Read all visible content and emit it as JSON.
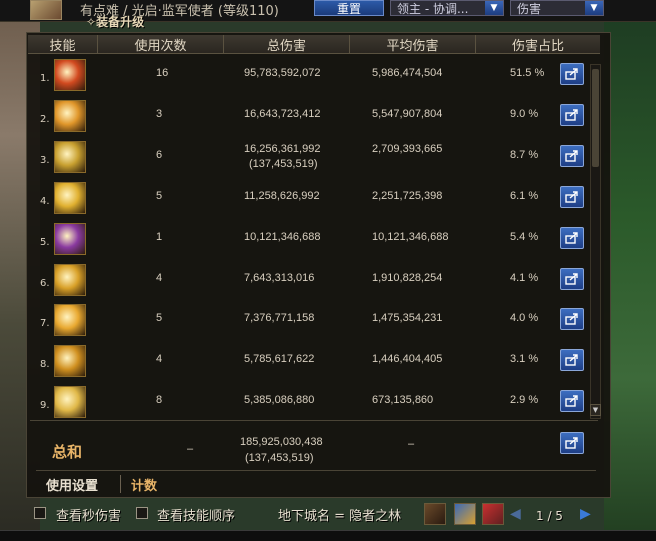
{
  "header": {
    "title": "有点难 / 光启·监军使者 (等级110)",
    "equip_upgrade": "装备升级",
    "reset_label": "重置",
    "dropdown_boss": "领主 - 协调...",
    "dropdown_metric": "伤害"
  },
  "table": {
    "columns": [
      "技能",
      "使用次数",
      "总伤害",
      "平均伤害",
      "伤害占比"
    ],
    "rows": [
      {
        "index": "1.",
        "uses": "16",
        "total": "95,783,592,072",
        "total_sub": "",
        "avg": "5,986,474,504",
        "pct": "51.5 %",
        "color": "#d24a20"
      },
      {
        "index": "2.",
        "uses": "3",
        "total": "16,643,723,412",
        "total_sub": "",
        "avg": "5,547,907,804",
        "pct": "9.0 %",
        "color": "#e0962a"
      },
      {
        "index": "3.",
        "uses": "6",
        "total": "16,256,361,992",
        "total_sub": "(137,453,519)",
        "avg": "2,709,393,665",
        "pct": "8.7 %",
        "color": "#c8a030"
      },
      {
        "index": "4.",
        "uses": "5",
        "total": "11,258,626,992",
        "total_sub": "",
        "avg": "2,251,725,398",
        "pct": "6.1 %",
        "color": "#e0b030"
      },
      {
        "index": "5.",
        "uses": "1",
        "total": "10,121,346,688",
        "total_sub": "",
        "avg": "10,121,346,688",
        "pct": "5.4 %",
        "color": "#8a3aa0"
      },
      {
        "index": "6.",
        "uses": "4",
        "total": "7,643,313,016",
        "total_sub": "",
        "avg": "1,910,828,254",
        "pct": "4.1 %",
        "color": "#d8a028"
      },
      {
        "index": "7.",
        "uses": "5",
        "total": "7,376,771,158",
        "total_sub": "",
        "avg": "1,475,354,231",
        "pct": "4.0 %",
        "color": "#e8a830"
      },
      {
        "index": "8.",
        "uses": "4",
        "total": "5,785,617,622",
        "total_sub": "",
        "avg": "1,446,404,405",
        "pct": "3.1 %",
        "color": "#d09020"
      },
      {
        "index": "9.",
        "uses": "8",
        "total": "5,385,086,880",
        "total_sub": "",
        "avg": "673,135,860",
        "pct": "2.9 %",
        "color": "#e0b848"
      }
    ],
    "total_row": {
      "label": "总和",
      "uses": "–",
      "total": "185,925,030,438",
      "total_sub": "(137,453,519)",
      "avg": "–"
    }
  },
  "tabs": {
    "settings": "使用设置",
    "count": "计数"
  },
  "bottom": {
    "show_dps": "查看秒伤害",
    "show_skill_order": "查看技能顺序",
    "dungeon": "地下城名 = 隐者之林",
    "page": "1 / 5"
  },
  "colors": {
    "accent_blue": "#2c5aa8",
    "total_orange": "#e8b468",
    "tab_active": "#e8b468"
  }
}
